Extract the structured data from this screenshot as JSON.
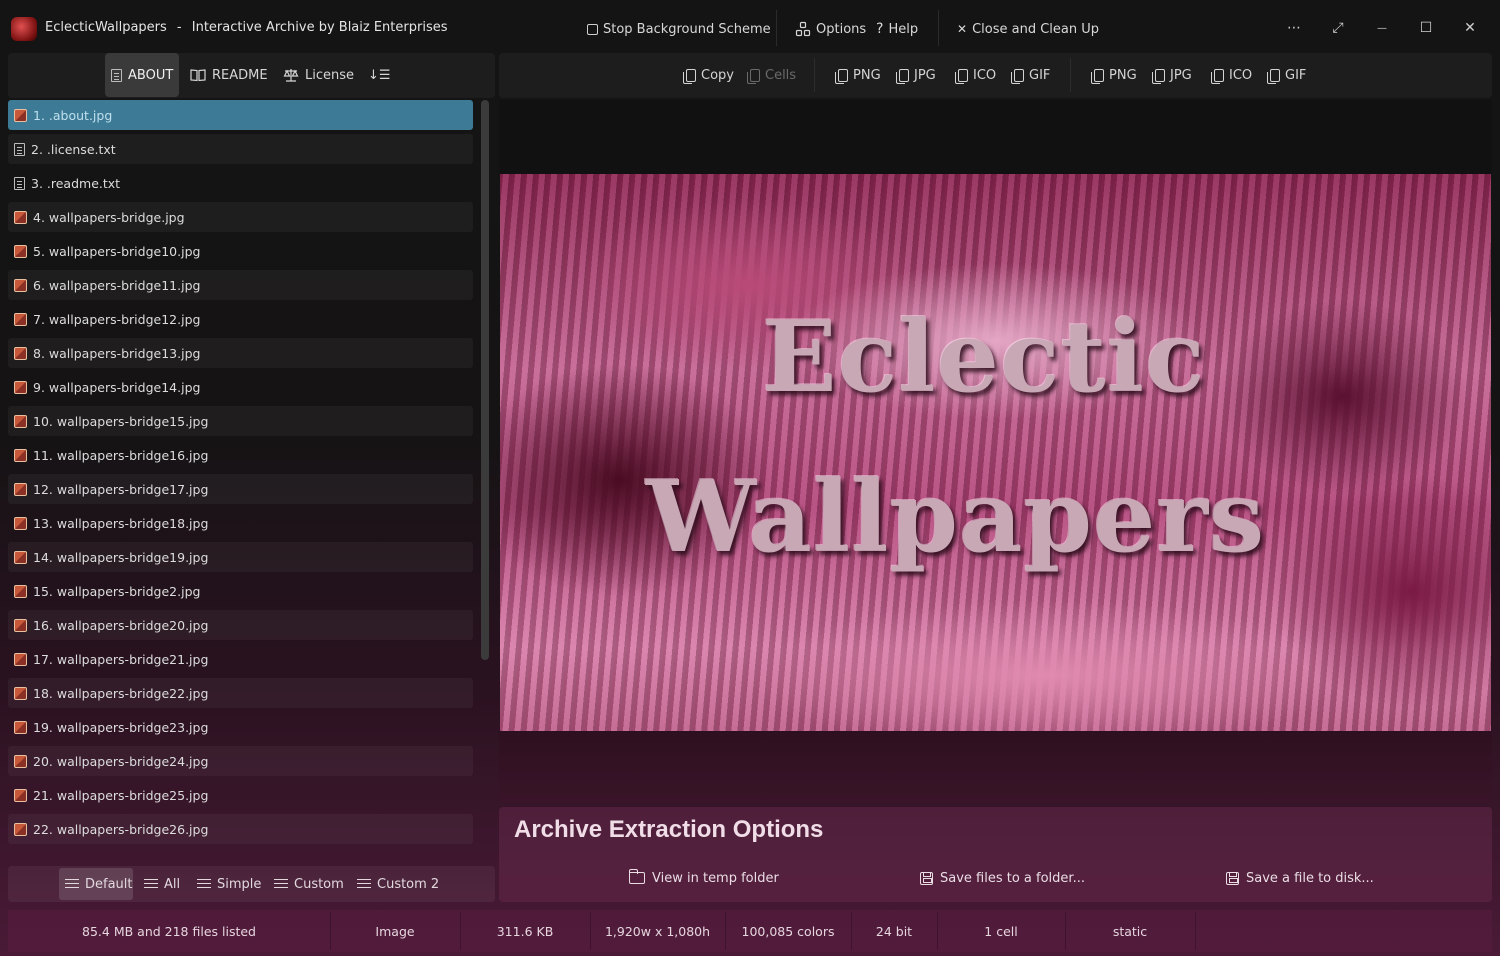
{
  "window": {
    "app_name": "EclecticWallpapers",
    "title_separator": "-",
    "subtitle": "Interactive Archive by Blaiz Enterprises",
    "controls": {
      "more": "⋯",
      "fullscreen": "⤢",
      "minimize": "—",
      "maximize": "☐",
      "close": "✕"
    }
  },
  "titlebar": {
    "stop_bg_label": "Stop Background Scheme",
    "options_label": "Options",
    "help_icon": "?",
    "help_label": "Help",
    "close_cleanup_icon": "✕",
    "close_cleanup_label": "Close and Clean Up"
  },
  "left_tabs": {
    "about": "ABOUT",
    "readme": "README",
    "license": "License",
    "sort_icon": "↓☰"
  },
  "right_toolbar": {
    "copy": "Copy",
    "cells": "Cells",
    "group1": [
      "PNG",
      "JPG",
      "ICO",
      "GIF"
    ],
    "group2": [
      "PNG",
      "JPG",
      "ICO",
      "GIF"
    ]
  },
  "files": [
    {
      "label": "1. .about.jpg",
      "type": "image",
      "selected": true
    },
    {
      "label": "2. .license.txt",
      "type": "text"
    },
    {
      "label": "3. .readme.txt",
      "type": "text"
    },
    {
      "label": "4. wallpapers-bridge.jpg",
      "type": "image"
    },
    {
      "label": "5. wallpapers-bridge10.jpg",
      "type": "image"
    },
    {
      "label": "6. wallpapers-bridge11.jpg",
      "type": "image"
    },
    {
      "label": "7. wallpapers-bridge12.jpg",
      "type": "image"
    },
    {
      "label": "8. wallpapers-bridge13.jpg",
      "type": "image"
    },
    {
      "label": "9. wallpapers-bridge14.jpg",
      "type": "image"
    },
    {
      "label": "10. wallpapers-bridge15.jpg",
      "type": "image"
    },
    {
      "label": "11. wallpapers-bridge16.jpg",
      "type": "image"
    },
    {
      "label": "12. wallpapers-bridge17.jpg",
      "type": "image"
    },
    {
      "label": "13. wallpapers-bridge18.jpg",
      "type": "image"
    },
    {
      "label": "14. wallpapers-bridge19.jpg",
      "type": "image"
    },
    {
      "label": "15. wallpapers-bridge2.jpg",
      "type": "image"
    },
    {
      "label": "16. wallpapers-bridge20.jpg",
      "type": "image"
    },
    {
      "label": "17. wallpapers-bridge21.jpg",
      "type": "image"
    },
    {
      "label": "18. wallpapers-bridge22.jpg",
      "type": "image"
    },
    {
      "label": "19. wallpapers-bridge23.jpg",
      "type": "image"
    },
    {
      "label": "20. wallpapers-bridge24.jpg",
      "type": "image"
    },
    {
      "label": "21. wallpapers-bridge25.jpg",
      "type": "image"
    },
    {
      "label": "22. wallpapers-bridge26.jpg",
      "type": "image"
    }
  ],
  "view_tabs": {
    "default": "Default",
    "all": "All",
    "simple": "Simple",
    "custom": "Custom",
    "custom2": "Custom 2"
  },
  "preview": {
    "line1": "Eclectic",
    "line2": "Wallpapers"
  },
  "extraction": {
    "title": "Archive Extraction Options",
    "view_temp": "View in temp folder",
    "save_folder": "Save files to a folder...",
    "save_file": "Save a file to disk..."
  },
  "status": {
    "summary": "85.4 MB and 218 files listed",
    "kind": "Image",
    "size": "311.6 KB",
    "dimensions": "1,920w x 1,080h",
    "colors": "100,085 colors",
    "depth": "24 bit",
    "cells": "1 cell",
    "animation": "static"
  }
}
